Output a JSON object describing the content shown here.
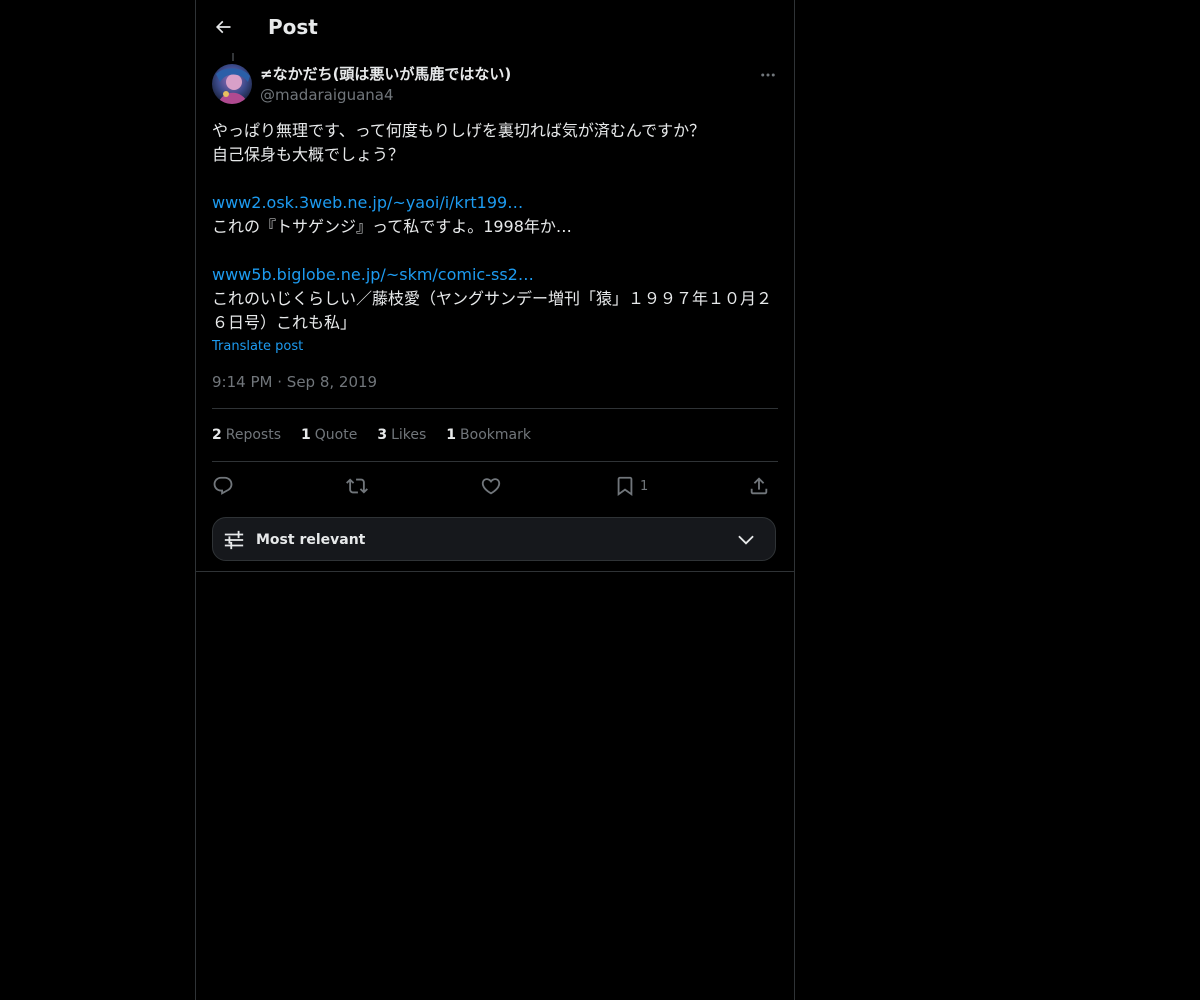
{
  "header": {
    "title": "Post",
    "back_icon": "arrow-left-icon"
  },
  "author": {
    "display_name": "≠なかだち(頭は悪いが馬鹿ではない)",
    "handle": "@madaraiguana4",
    "avatar_icon": "avatar-image"
  },
  "post": {
    "lines": [
      "やっぱり無理です、って何度もりしげを裏切れば気が済むんですか？",
      "自己保身も大概でしょう？",
      "",
      "www2.osk.3web.ne.jp/~yaoi/i/krt199…",
      "これの『トサゲンジ』って私ですよ。1998年か…",
      "",
      "www5b.biglobe.ne.jp/~skm/comic-ss2…",
      "これのいじくらしい／藤枝愛（ヤングサンデー増刊「猿」１９９７年１０月２６日号）これも私」"
    ],
    "translate_label": "Translate post",
    "timestamp_time": "9:14 PM",
    "timestamp_sep": "·",
    "timestamp_date": "Sep 8, 2019"
  },
  "stats": {
    "reposts_count": "2",
    "reposts_label": "Reposts",
    "quotes_count": "1",
    "quotes_label": "Quote",
    "likes_count": "3",
    "likes_label": "Likes",
    "bookmarks_count": "1",
    "bookmarks_label": "Bookmark"
  },
  "actions": {
    "reply_icon": "reply-icon",
    "repost_icon": "repost-icon",
    "like_icon": "heart-icon",
    "bookmark_icon": "bookmark-icon",
    "bookmark_count": "1",
    "share_icon": "share-icon"
  },
  "sort": {
    "label": "Most relevant",
    "icon": "sliders-icon",
    "chevron": "chevron-down-icon"
  },
  "colors": {
    "background": "#000000",
    "text": "#e7e9ea",
    "muted": "#71767b",
    "link": "#1d9bf0",
    "border": "#2f3336"
  }
}
